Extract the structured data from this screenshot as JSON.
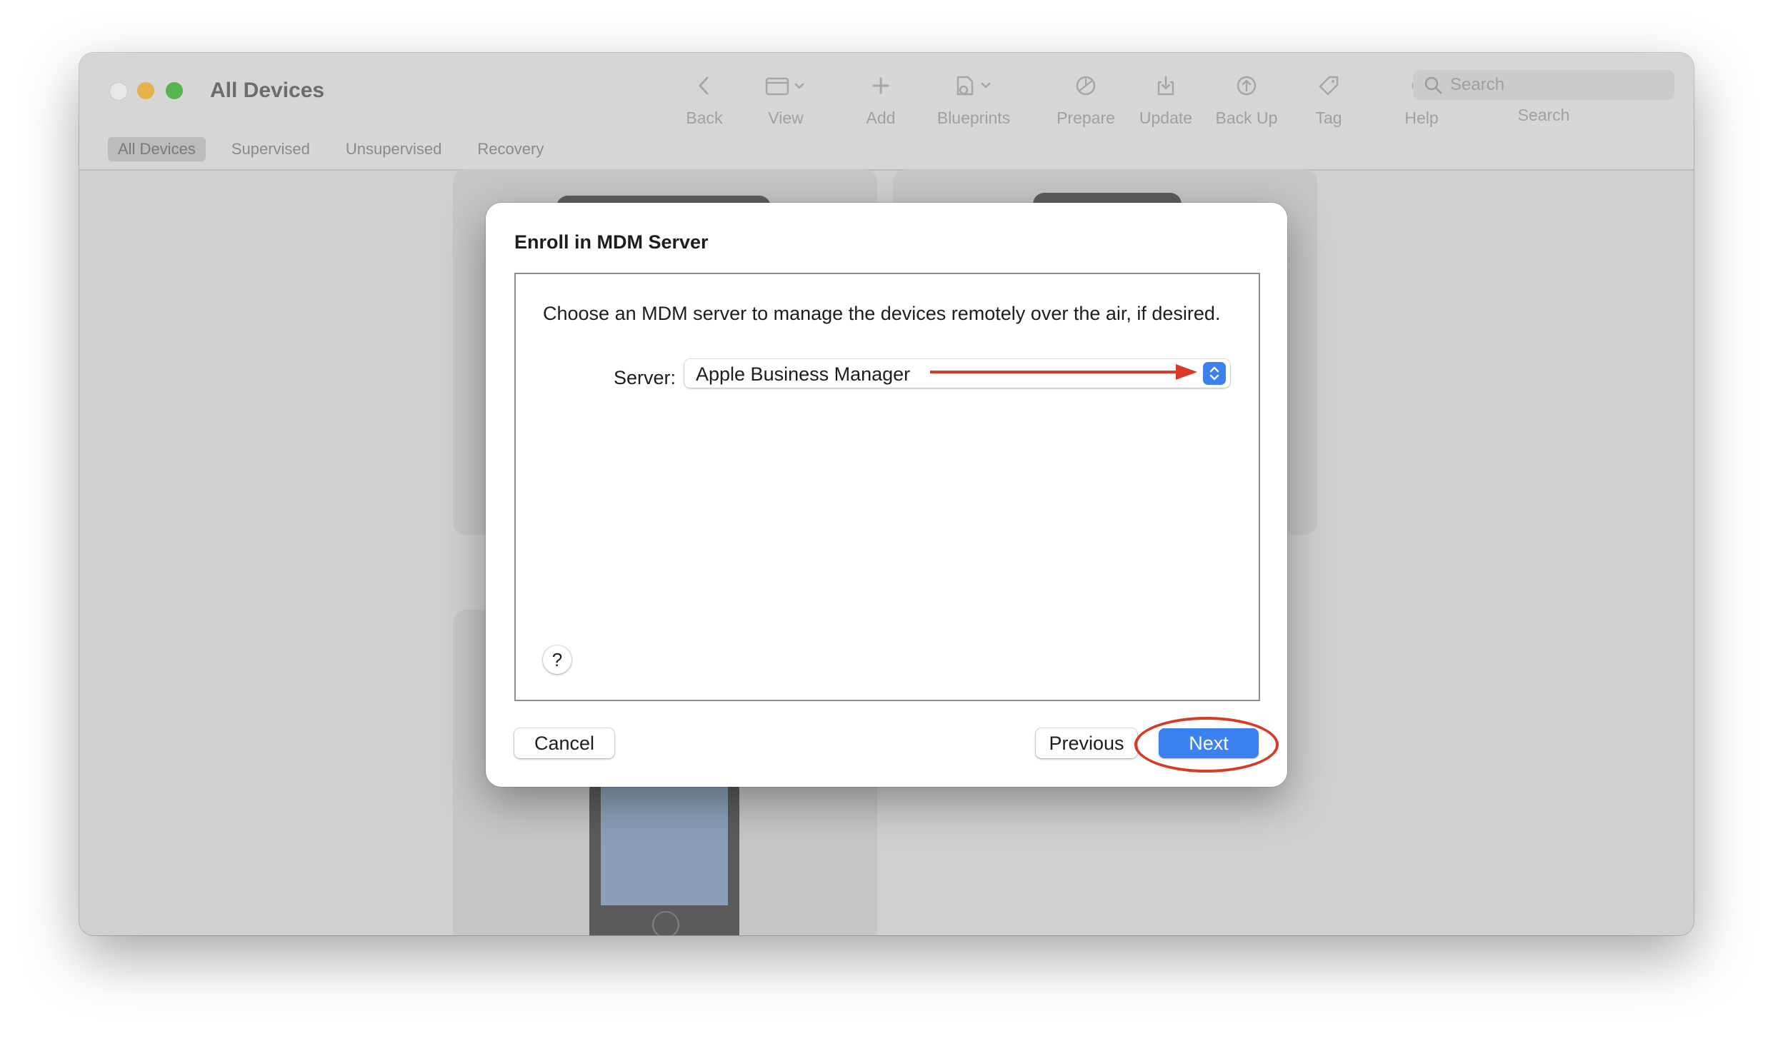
{
  "window": {
    "title": "All Devices"
  },
  "toolbar": {
    "items": [
      {
        "label": "Back",
        "icon": "chevron-left-icon"
      },
      {
        "label": "View",
        "icon": "view-icon"
      },
      {
        "label": "Add",
        "icon": "plus-icon"
      },
      {
        "label": "Blueprints",
        "icon": "blueprints-icon"
      },
      {
        "label": "Prepare",
        "icon": "prepare-icon"
      },
      {
        "label": "Update",
        "icon": "update-icon"
      },
      {
        "label": "Back Up",
        "icon": "back-up-icon"
      },
      {
        "label": "Tag",
        "icon": "tag-icon"
      },
      {
        "label": "Help",
        "icon": "help-icon"
      }
    ],
    "search": {
      "placeholder": "Search",
      "label": "Search"
    }
  },
  "tabs": [
    {
      "label": "All Devices",
      "active": true
    },
    {
      "label": "Supervised",
      "active": false
    },
    {
      "label": "Unsupervised",
      "active": false
    },
    {
      "label": "Recovery",
      "active": false
    }
  ],
  "dialog": {
    "title": "Enroll in MDM Server",
    "instruction": "Choose an MDM server to manage the devices remotely over the air, if desired.",
    "server_label": "Server:",
    "server_value": "Apple Business Manager",
    "help_label": "?",
    "buttons": {
      "cancel": "Cancel",
      "previous": "Previous",
      "next": "Next"
    }
  },
  "colors": {
    "accent": "#3b82f0",
    "annotation": "#d73b28"
  }
}
